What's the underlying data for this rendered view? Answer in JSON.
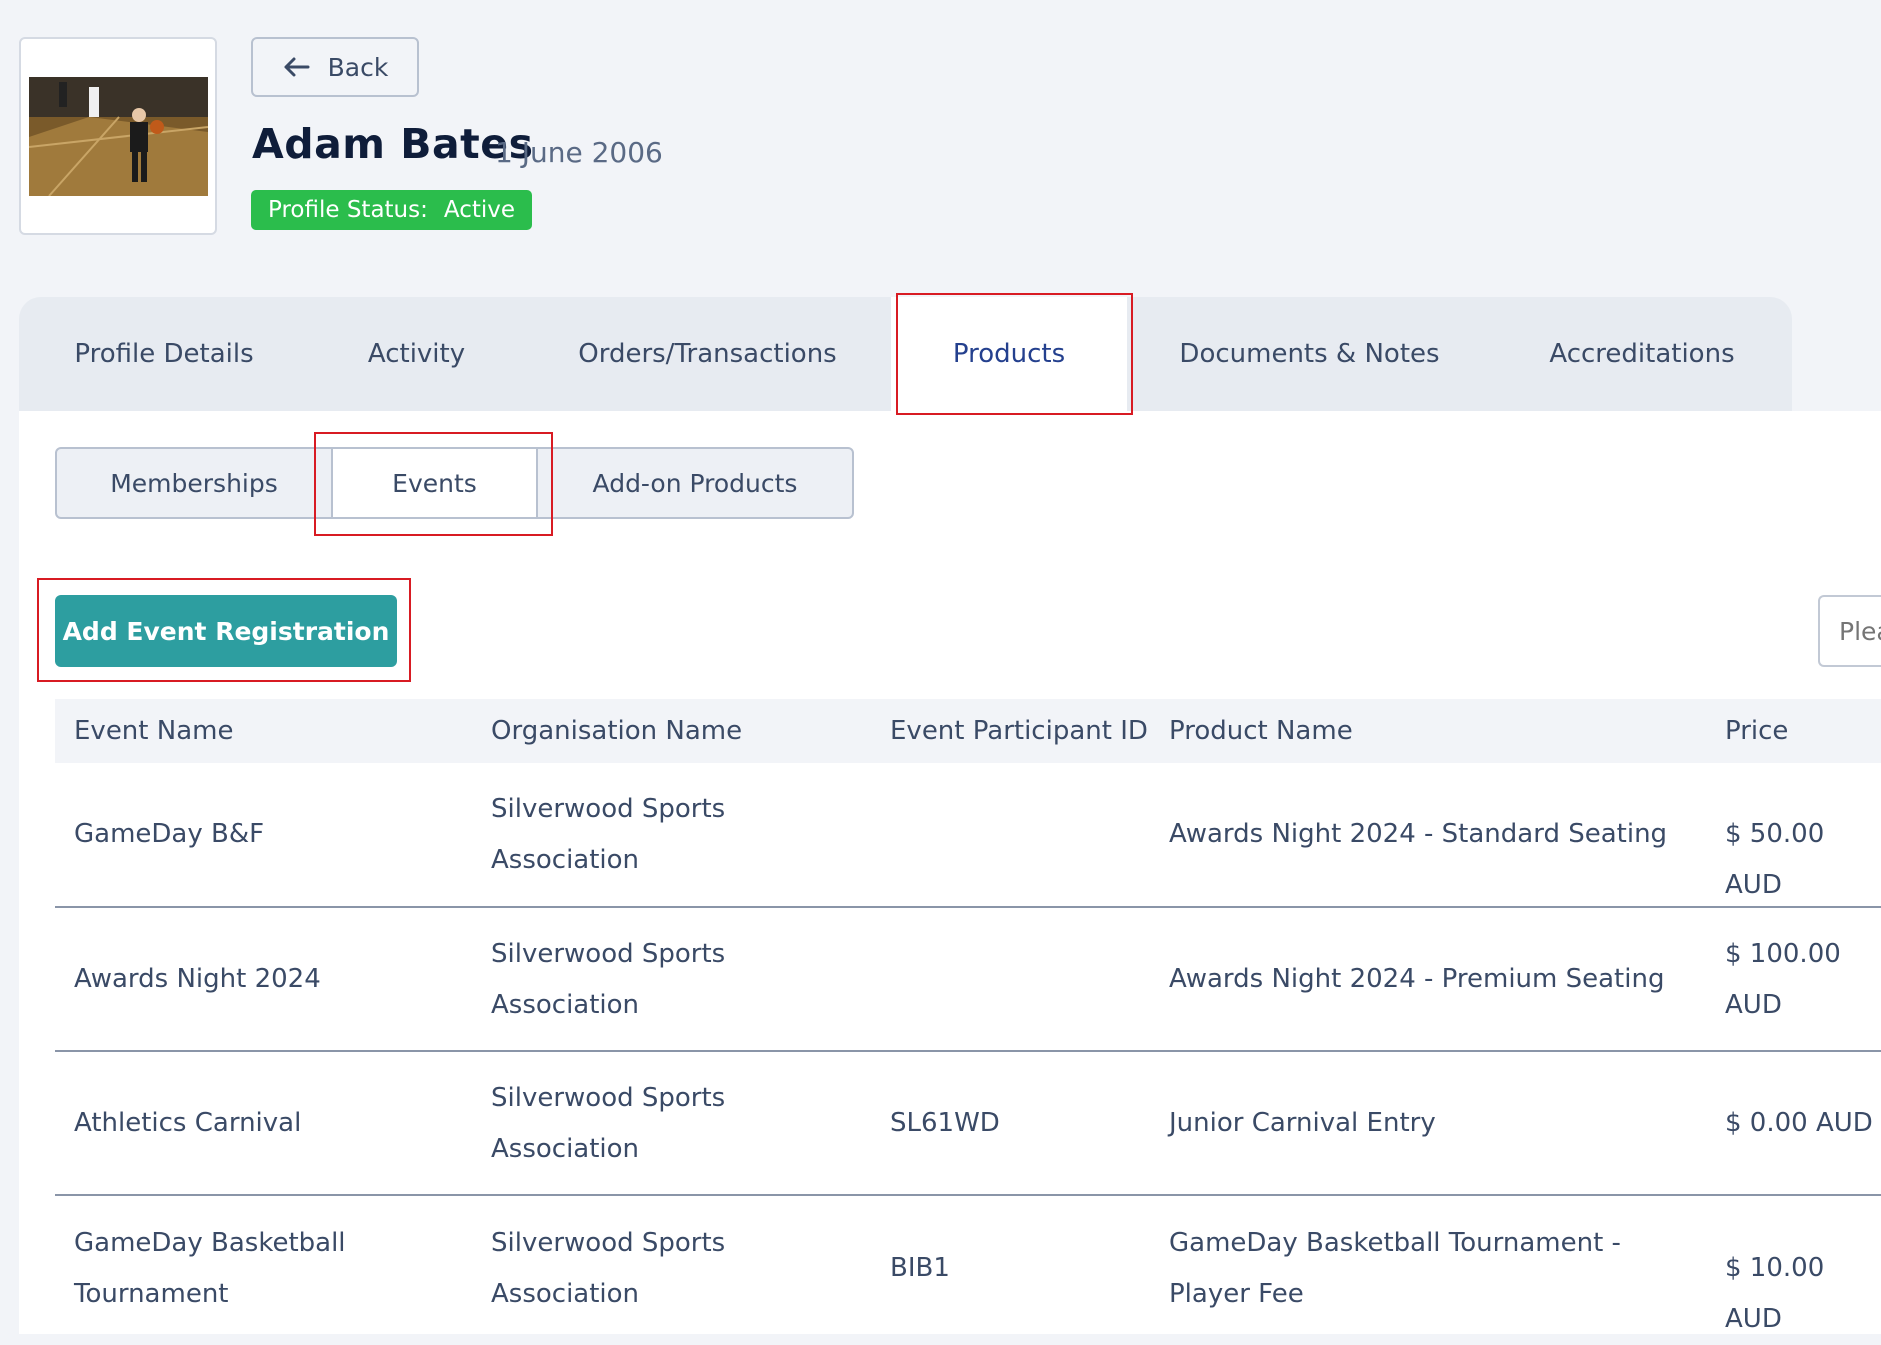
{
  "profile": {
    "back_label": "Back",
    "name": "Adam Bates",
    "dob": "1 June 2006",
    "status_label": "Profile Status:",
    "status_value": "Active"
  },
  "tabs": [
    "Profile Details",
    "Activity",
    "Orders/Transactions",
    "Products",
    "Documents & Notes",
    "Accreditations"
  ],
  "active_tab": "Products",
  "subtabs": [
    "Memberships",
    "Events",
    "Add-on Products"
  ],
  "active_subtab": "Events",
  "add_button_label": "Add Event Registration",
  "search_placeholder": "Plea",
  "table": {
    "headers": [
      "Event Name",
      "Organisation Name",
      "Event Participant ID",
      "Product Name",
      "Price"
    ],
    "rows": [
      {
        "event": "GameDay B&F",
        "org": "Silverwood Sports Association",
        "pid": "",
        "product": "Awards Night 2024 - Standard Seating",
        "price": "$ 50.00 AUD"
      },
      {
        "event": "Awards Night 2024",
        "org": "Silverwood Sports Association",
        "pid": "",
        "product": "Awards Night 2024 - Premium Seating",
        "price": "$ 100.00 AUD"
      },
      {
        "event": "Athletics Carnival",
        "org": "Silverwood Sports Association",
        "pid": "SL61WD",
        "product": "Junior Carnival Entry",
        "price": "$ 0.00 AUD"
      },
      {
        "event": "GameDay Basketball Tournament",
        "org": "Silverwood Sports Association",
        "pid": "BIB1",
        "product": "GameDay Basketball Tournament - Player Fee",
        "price": "$ 10.00 AUD"
      }
    ]
  },
  "colors": {
    "accent": "#2d9ea0",
    "status": "#2bbd4c",
    "highlight": "#d81b23",
    "active_tab_text": "#24408e"
  }
}
